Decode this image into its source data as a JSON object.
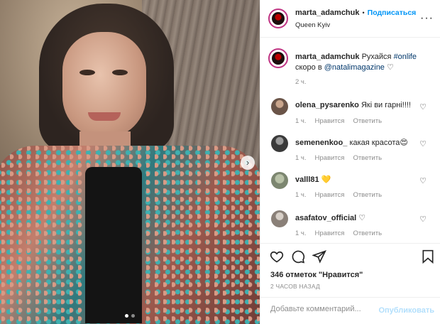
{
  "post": {
    "author": "marta_adamchuk",
    "follow_label": "Подписаться",
    "location": "Queen Kyiv",
    "separator": "•"
  },
  "caption": {
    "author": "marta_adamchuk",
    "text_1": "Рухайся",
    "hashtag": "#onlife",
    "text_2": "скоро в",
    "mention": "@natalimagazine",
    "heart": "♡",
    "time": "2 ч."
  },
  "comments": [
    {
      "user": "olena_pysarenko",
      "text": "Які ви гарні!!!!",
      "time": "1 ч.",
      "likes_label": "Нравится",
      "reply_label": "Ответить"
    },
    {
      "user": "semenenkoo_",
      "text": "какая красота",
      "emoji": "😍",
      "time": "1 ч.",
      "likes_label": "Нравится",
      "reply_label": "Ответить"
    },
    {
      "user": "valll81",
      "text": "",
      "emoji": "💛",
      "time": "1 ч.",
      "likes_label": "Нравится",
      "reply_label": "Ответить"
    },
    {
      "user": "asafatov_official",
      "text": "",
      "emoji": "♡",
      "time": "1 ч.",
      "likes_label": "Нравится",
      "reply_label": "Ответить"
    }
  ],
  "actions": {
    "likes": "346 отметок \"Нравится\"",
    "posted": "2 часов назад"
  },
  "composer": {
    "placeholder": "Добавьте комментарий...",
    "publish_label": "Опубликовать"
  },
  "carousel": {
    "slide_count": 2,
    "active_slide": 1
  },
  "colors": {
    "accent": "#0095f6",
    "link": "#00376b",
    "muted": "#8e8e8e",
    "publish_disabled": "#b2dffc"
  }
}
